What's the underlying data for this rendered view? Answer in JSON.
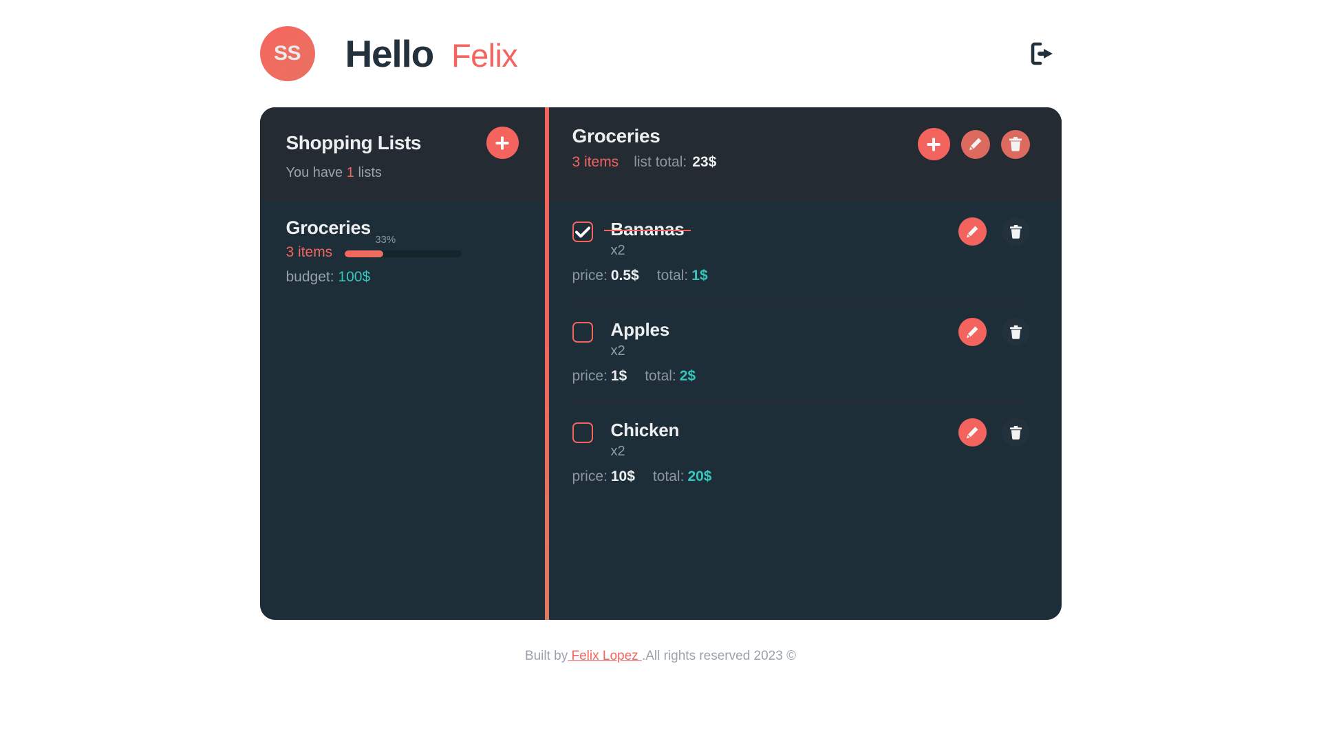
{
  "header": {
    "avatar_initials": "SS",
    "greeting": "Hello",
    "username": "Felix",
    "logout_icon": "logout-arrow-icon"
  },
  "sidebar": {
    "title": "Shopping Lists",
    "subtitle_prefix": "You have",
    "lists_count": "1",
    "subtitle_suffix": "lists",
    "add_button_icon": "plus-icon",
    "lists": [
      {
        "name": "Groceries",
        "items_count": "3 items",
        "progress_pct": "33%",
        "progress_value": 33,
        "budget_label": "budget:",
        "budget_value": "100$"
      }
    ]
  },
  "list_detail": {
    "title": "Groceries",
    "items_count": "3 items",
    "total_label": "list total:",
    "total_value": "23$",
    "actions": [
      {
        "name": "add-item-button",
        "icon": "plus-icon"
      },
      {
        "name": "edit-list-button",
        "icon": "pencil-icon"
      },
      {
        "name": "delete-list-button",
        "icon": "trash-icon"
      }
    ],
    "items": [
      {
        "name": "Bananas",
        "checked": true,
        "quantity": "x2",
        "price_label": "price:",
        "price_value": "0.5$",
        "total_label": "total:",
        "total_value": "1$"
      },
      {
        "name": "Apples",
        "checked": false,
        "quantity": "x2",
        "price_label": "price:",
        "price_value": "1$",
        "total_label": "total:",
        "total_value": "2$"
      },
      {
        "name": "Chicken",
        "checked": false,
        "quantity": "x2",
        "price_label": "price:",
        "price_value": "10$",
        "total_label": "total:",
        "total_value": "20$"
      }
    ]
  },
  "footer": {
    "prefix": "Built by",
    "link": " Felix Lopez ",
    "suffix": ".All rights reserved 2023 ©"
  },
  "colors": {
    "accent": "#f4645e",
    "teal": "#36c6bb",
    "panel_head": "#252b33",
    "panel_body": "#1d2e39",
    "text_dark": "#23313d"
  }
}
